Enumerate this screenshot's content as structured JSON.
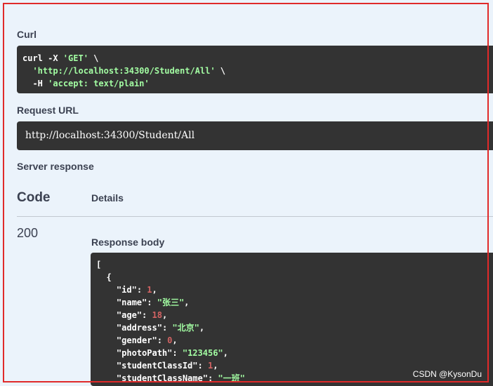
{
  "labels": {
    "curl": "Curl",
    "request_url": "Request URL",
    "server_response": "Server response",
    "code_col": "Code",
    "details_col": "Details",
    "response_body": "Response body"
  },
  "curl": {
    "cmd": "curl -X ",
    "method": "'GET'",
    "cont1": " \\",
    "url": "'http://localhost:34300/Student/All'",
    "cont2": " \\",
    "header_flag": "-H ",
    "header": "'accept: text/plain'"
  },
  "request_url": "http://localhost:34300/Student/All",
  "status_code": "200",
  "response_lines": [
    {
      "indent": "",
      "key": "",
      "sep": "",
      "val": "[",
      "type": "punct",
      "end": ""
    },
    {
      "indent": "  ",
      "key": "",
      "sep": "",
      "val": "{",
      "type": "punct",
      "end": ""
    },
    {
      "indent": "    ",
      "key": "\"id\"",
      "sep": ": ",
      "val": "1",
      "type": "num",
      "end": ","
    },
    {
      "indent": "    ",
      "key": "\"name\"",
      "sep": ": ",
      "val": "\"张三\"",
      "type": "str",
      "end": ","
    },
    {
      "indent": "    ",
      "key": "\"age\"",
      "sep": ": ",
      "val": "18",
      "type": "num",
      "end": ","
    },
    {
      "indent": "    ",
      "key": "\"address\"",
      "sep": ": ",
      "val": "\"北京\"",
      "type": "str",
      "end": ","
    },
    {
      "indent": "    ",
      "key": "\"gender\"",
      "sep": ": ",
      "val": "0",
      "type": "num",
      "end": ","
    },
    {
      "indent": "    ",
      "key": "\"photoPath\"",
      "sep": ": ",
      "val": "\"123456\"",
      "type": "str",
      "end": ","
    },
    {
      "indent": "    ",
      "key": "\"studentClassId\"",
      "sep": ": ",
      "val": "1",
      "type": "num",
      "end": ","
    },
    {
      "indent": "    ",
      "key": "\"studentClassName\"",
      "sep": ": ",
      "val": "\"一班\"",
      "type": "str",
      "end": ""
    }
  ],
  "watermark": "CSDN @KysonDu",
  "colors": {
    "panel_bg": "#ebf3fb",
    "code_bg": "#333333",
    "string": "#a2fca2",
    "number": "#d36363",
    "frame": "#e02a2a"
  }
}
